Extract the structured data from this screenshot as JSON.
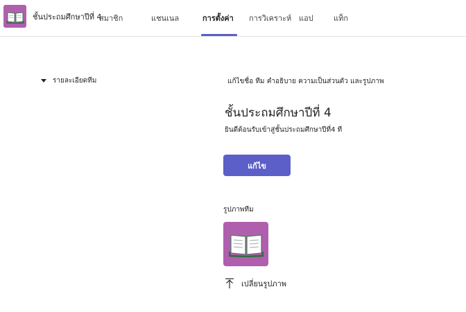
{
  "team": {
    "name": "ชั้นประถมศึกษาปีที่ 4",
    "avatar_icon": "open-book-icon",
    "avatar_color": "#b05fae"
  },
  "tabs": [
    {
      "label": "สมาชิก",
      "active": false
    },
    {
      "label": "แชนเนล",
      "active": false
    },
    {
      "label": "การตั้งค่า",
      "active": true
    },
    {
      "label": "การวิเคราะห์",
      "active": false
    },
    {
      "label": "แอป",
      "active": false
    },
    {
      "label": "แท็ก",
      "active": false
    }
  ],
  "accent_color": "#5b5fc7",
  "section": {
    "toggle_label": "รายละเอียดทีม",
    "subtitle": "แก้ไขชื่อ ทีม คำอธิบาย ความเป็นส่วนตัว และรูปภาพ",
    "team_title": "ชั้นประถมศึกษาปีที่ 4",
    "description": "ยินดีต้อนรับเข้าสู่ชั้นประถมศึกษาปีที่4 ที",
    "edit_button": "แก้ไข",
    "picture_label": "รูปภาพทีม",
    "change_picture": "เปลี่ยนรูปภาพ"
  }
}
